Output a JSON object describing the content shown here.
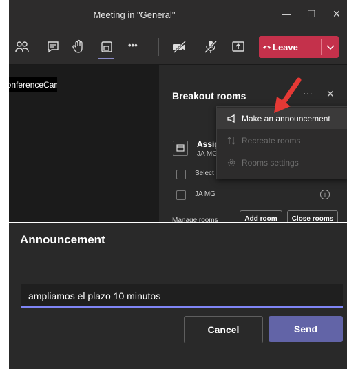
{
  "window": {
    "title": "Meeting in \"General\"",
    "minimize": "—",
    "maximize": "☐",
    "close": "✕"
  },
  "toolbar": {
    "leave_label": "Leave",
    "more": "•••"
  },
  "video": {
    "cam_label": "ConferenceCam"
  },
  "panel": {
    "title": "Breakout rooms",
    "more": "···",
    "close": "✕",
    "assign_title": "Assig",
    "assign_sub": "JA MG",
    "rows": [
      {
        "label": "Select"
      },
      {
        "label": "JA MG"
      }
    ],
    "info": "i",
    "manage_label": "Manage rooms",
    "add_room": "Add room",
    "close_rooms": "Close rooms"
  },
  "menu": {
    "items": [
      {
        "label": "Make an announcement",
        "enabled": true
      },
      {
        "label": "Recreate rooms",
        "enabled": false
      },
      {
        "label": "Rooms settings",
        "enabled": false
      }
    ]
  },
  "announcement": {
    "title": "Announcement",
    "input_value": "ampliamos el plazo 10 minutos",
    "cancel": "Cancel",
    "send": "Send"
  },
  "colors": {
    "leave": "#c4314b",
    "send": "#6264a7",
    "accent": "#8b8cc7",
    "arrow": "#e53935"
  }
}
